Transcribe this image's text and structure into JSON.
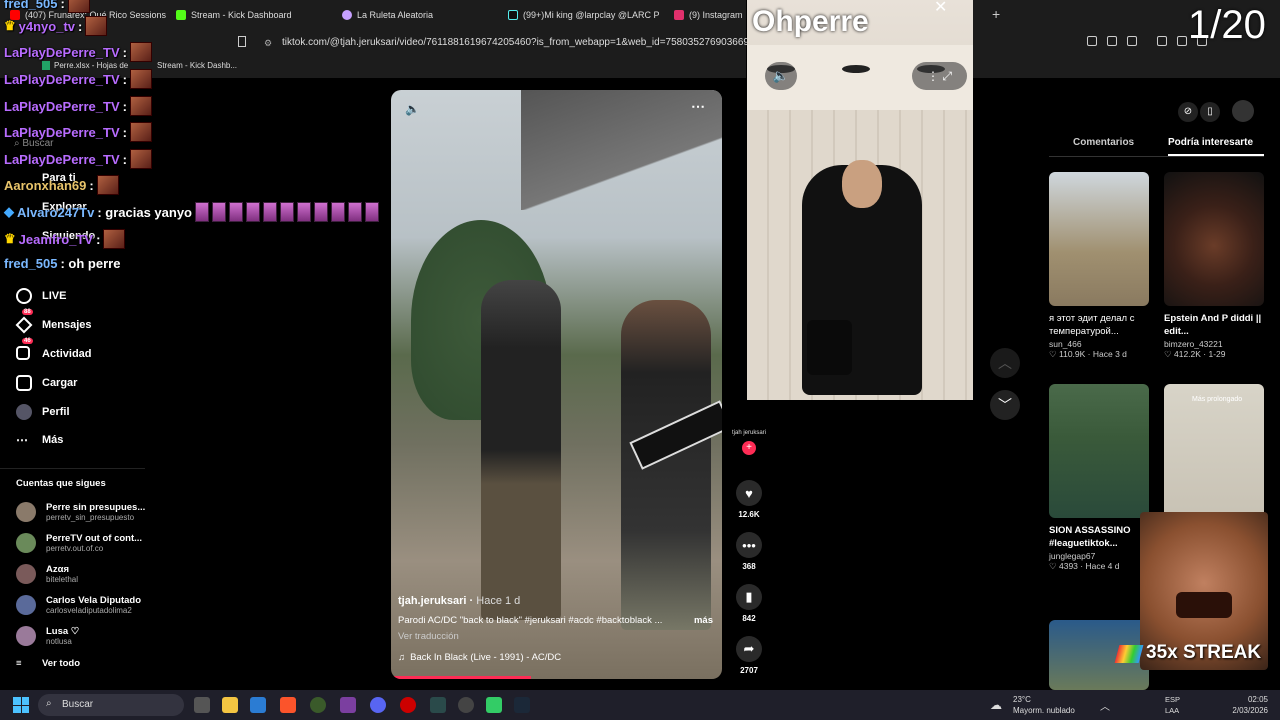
{
  "browser_tabs": [
    "(407) Frunarex: Qué Rico Sessions, V",
    "Stream - Kick Dashboard",
    "La Ruleta Aleatoria",
    "(99+)Mi king @larpclay @LARC P",
    "(9) Instagram"
  ],
  "address": "tiktok.com/@tjah.jeruksari/video/7611881619674205460?is_from_webapp=1&web_id=7580352769036699144",
  "bookmarks": [
    "Perre.xlsx - Hojas de",
    "Stream - Kick Dashb..."
  ],
  "search_placeholder": "Buscar",
  "nav": {
    "para_ti": "Para ti",
    "explorar": "Explorar",
    "siguiendo": "Siguiendo",
    "live": "LIVE",
    "mensajes": "Mensajes",
    "mensajes_badge": "88",
    "actividad": "Actividad",
    "actividad_badge": "46",
    "cargar": "Cargar",
    "perfil": "Perfil",
    "mas": "Más"
  },
  "following_title": "Cuentas que sigues",
  "following": [
    {
      "name": "Perre sin presupues...",
      "user": "perretv_sin_presupuesto"
    },
    {
      "name": "PerreTV out of cont...",
      "user": "perretv.out.of.co"
    },
    {
      "name": "Azαя",
      "user": "bitelethal"
    },
    {
      "name": "Carlos Vela Diputado",
      "user": "carlosveladiputadolima2"
    },
    {
      "name": "Lusa ♡",
      "user": "notlusa"
    }
  ],
  "see_all": "Ver todo",
  "chat": [
    {
      "user": "fred_505",
      "msg": ":"
    },
    {
      "user": "y4nyo_tv",
      "msg": ":"
    },
    {
      "user": "LaPlayDePerre_TV",
      "msg": ":"
    },
    {
      "user": "LaPlayDePerre_TV",
      "msg": ":"
    },
    {
      "user": "LaPlayDePerre_TV",
      "msg": ":"
    },
    {
      "user": "LaPlayDePerre_TV",
      "msg": ":"
    },
    {
      "user": "LaPlayDePerre_TV",
      "msg": ":"
    },
    {
      "user": "Aaronxhan69",
      "msg": ":"
    },
    {
      "user": "Alvaro247Tv",
      "msg": ": gracias yanyo"
    },
    {
      "user": "Jeamfro_TV",
      "msg": ":"
    },
    {
      "user": "fred_505",
      "msg": ": oh perre"
    }
  ],
  "video": {
    "author": "tjah.jeruksari",
    "time": "Hace 1 d",
    "caption": "Parodi AC/DC \"back to black\" #jeruksari #acdc #backtoblack ...",
    "more": "más",
    "translate": "Ver traducción",
    "music": "Back In Black (Live - 1991) - AC/DC"
  },
  "actions": {
    "likes": "12.6K",
    "comments": "368",
    "saves": "842",
    "shares": "2707",
    "avatar_label": "tjah jeruksari"
  },
  "overlay": {
    "name": "Ohperre",
    "counter": "1/20",
    "streak": "35x STREAK"
  },
  "right_tabs": [
    "Comentarios",
    "Podría interesarte"
  ],
  "cards": [
    {
      "title": "я этот эдит делал с температурой...",
      "user": "sun_466",
      "stats": "110.9K · Hace 3 d"
    },
    {
      "title": "Epstein And P diddi || edit...",
      "user": "bimzero_43221",
      "stats": "412.2K · 1-29"
    },
    {
      "title": "SION ASSASSINO #leaguetiktok...",
      "user": "junglegap67",
      "stats": "4393 · Hace 4 d"
    },
    {
      "title": "",
      "user": "",
      "stats": ""
    }
  ],
  "card4_overlay": "Más prolongado",
  "taskbar": {
    "search": "Buscar",
    "weather_temp": "23°C",
    "weather_desc": "Mayorm. nublado",
    "lang": "ESP",
    "lang2": "LAA",
    "time": "02:05",
    "date": "2/03/2026"
  },
  "colors": {
    "accent": "#fe2c55",
    "chat_user": "#b86cff",
    "chat_user2": "#e8c46a"
  }
}
